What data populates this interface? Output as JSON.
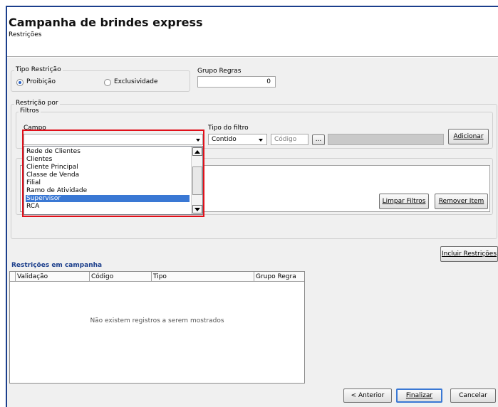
{
  "header": {
    "title": "Campanha de brindes express",
    "subtitle": "Restrições"
  },
  "tipo_restricao": {
    "legend": "Tipo Restrição",
    "options": [
      "Proibição",
      "Exclusividade"
    ],
    "selected": "Proibição"
  },
  "grupo_regras": {
    "label": "Grupo Regras",
    "value": "0"
  },
  "restricao_por": {
    "legend": "Restrição por"
  },
  "filtros": {
    "legend": "Filtros",
    "campo_label": "Campo",
    "campo_value": "",
    "tipo_filtro_label": "Tipo do filtro",
    "tipo_filtro_value": "Contido",
    "codigo_placeholder": "Código",
    "ellipsis_label": "...",
    "adicionar_label": "Adicionar"
  },
  "campo_dropdown": {
    "items": [
      "Rede de Clientes",
      "Clientes",
      "Cliente Principal",
      "Classe de Venda",
      "Filial",
      "Ramo de Atividade",
      "Supervisor",
      "RCA"
    ],
    "selected": "Supervisor"
  },
  "filter_buttons": {
    "limpar_label": "Limpar Filtros",
    "remover_label": "Remover Item"
  },
  "incluir_label": "Incluir Restrições",
  "restricoes": {
    "title": "Restrições em campanha",
    "columns": [
      "Validação",
      "Código",
      "Tipo",
      "Grupo Regra"
    ],
    "empty_message": "Não existem registros a serem mostrados"
  },
  "footer": {
    "anterior_label": "< Anterior",
    "finalizar_label": "Finalizar",
    "cancelar_label": "Cancelar"
  },
  "colors": {
    "highlight": "#e0101a",
    "selection": "#3a78d4",
    "section_title": "#1c3f8c",
    "frame": "#1c3f8c"
  },
  "icons": [
    "dropdown-arrow-icon",
    "radio-icon",
    "scroll-up-icon",
    "scroll-down-icon"
  ]
}
